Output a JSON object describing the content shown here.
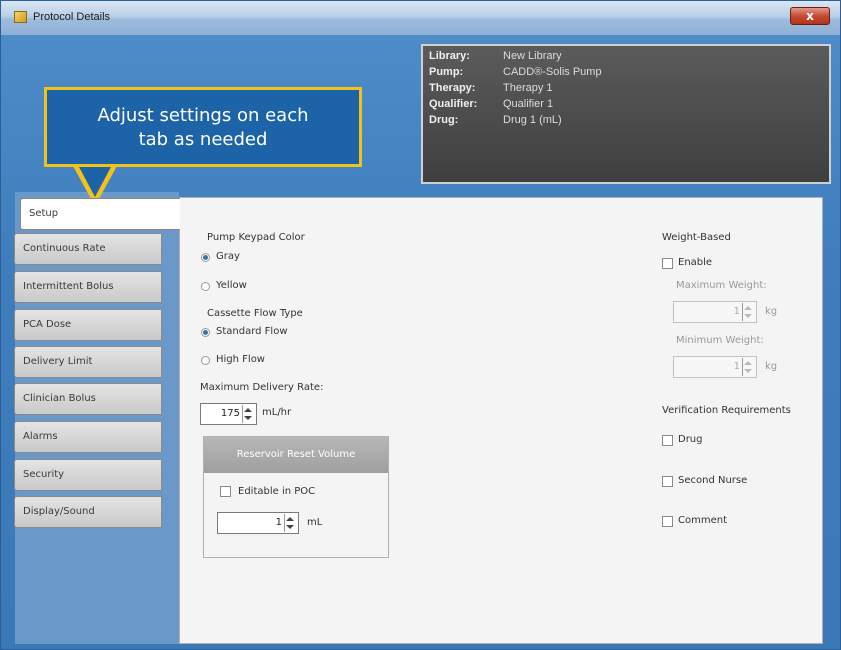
{
  "window": {
    "title": "Protocol Details",
    "close_label": "x"
  },
  "info": {
    "rows": [
      {
        "key": "Library:",
        "value": "New Library"
      },
      {
        "key": "Pump:",
        "value": "CADD®-Solis Pump"
      },
      {
        "key": "Therapy:",
        "value": "Therapy 1"
      },
      {
        "key": "Qualifier:",
        "value": "Qualifier 1"
      },
      {
        "key": "Drug:",
        "value": "Drug 1 (mL)"
      }
    ]
  },
  "callout": {
    "line1": "Adjust settings on each",
    "line2": "tab as needed"
  },
  "tabs": [
    {
      "label": "Setup",
      "active": true
    },
    {
      "label": "Continuous Rate"
    },
    {
      "label": "Intermittent Bolus"
    },
    {
      "label": "PCA Dose"
    },
    {
      "label": "Delivery Limit"
    },
    {
      "label": "Clinician Bolus"
    },
    {
      "label": "Alarms"
    },
    {
      "label": "Security"
    },
    {
      "label": "Display/Sound"
    }
  ],
  "setup": {
    "keypad_color": {
      "heading": "Pump Keypad Color",
      "options": [
        "Gray",
        "Yellow"
      ],
      "selected": "Gray"
    },
    "flow_type": {
      "heading": "Cassette Flow Type",
      "options": [
        "Standard Flow",
        "High Flow"
      ],
      "selected": "Standard Flow"
    },
    "max_rate": {
      "label": "Maximum Delivery Rate:",
      "value": "175",
      "unit": "mL/hr"
    },
    "reservoir": {
      "heading": "Reservoir Reset Volume",
      "editable_label": "Editable in POC",
      "value": "1",
      "unit": "mL"
    },
    "weight": {
      "heading": "Weight-Based",
      "enable_label": "Enable",
      "max_label": "Maximum Weight:",
      "max_value": "1",
      "min_label": "Minimum Weight:",
      "min_value": "1",
      "unit": "kg"
    },
    "verification": {
      "heading": "Verification Requirements",
      "items": [
        "Drug",
        "Second Nurse",
        "Comment"
      ]
    }
  }
}
